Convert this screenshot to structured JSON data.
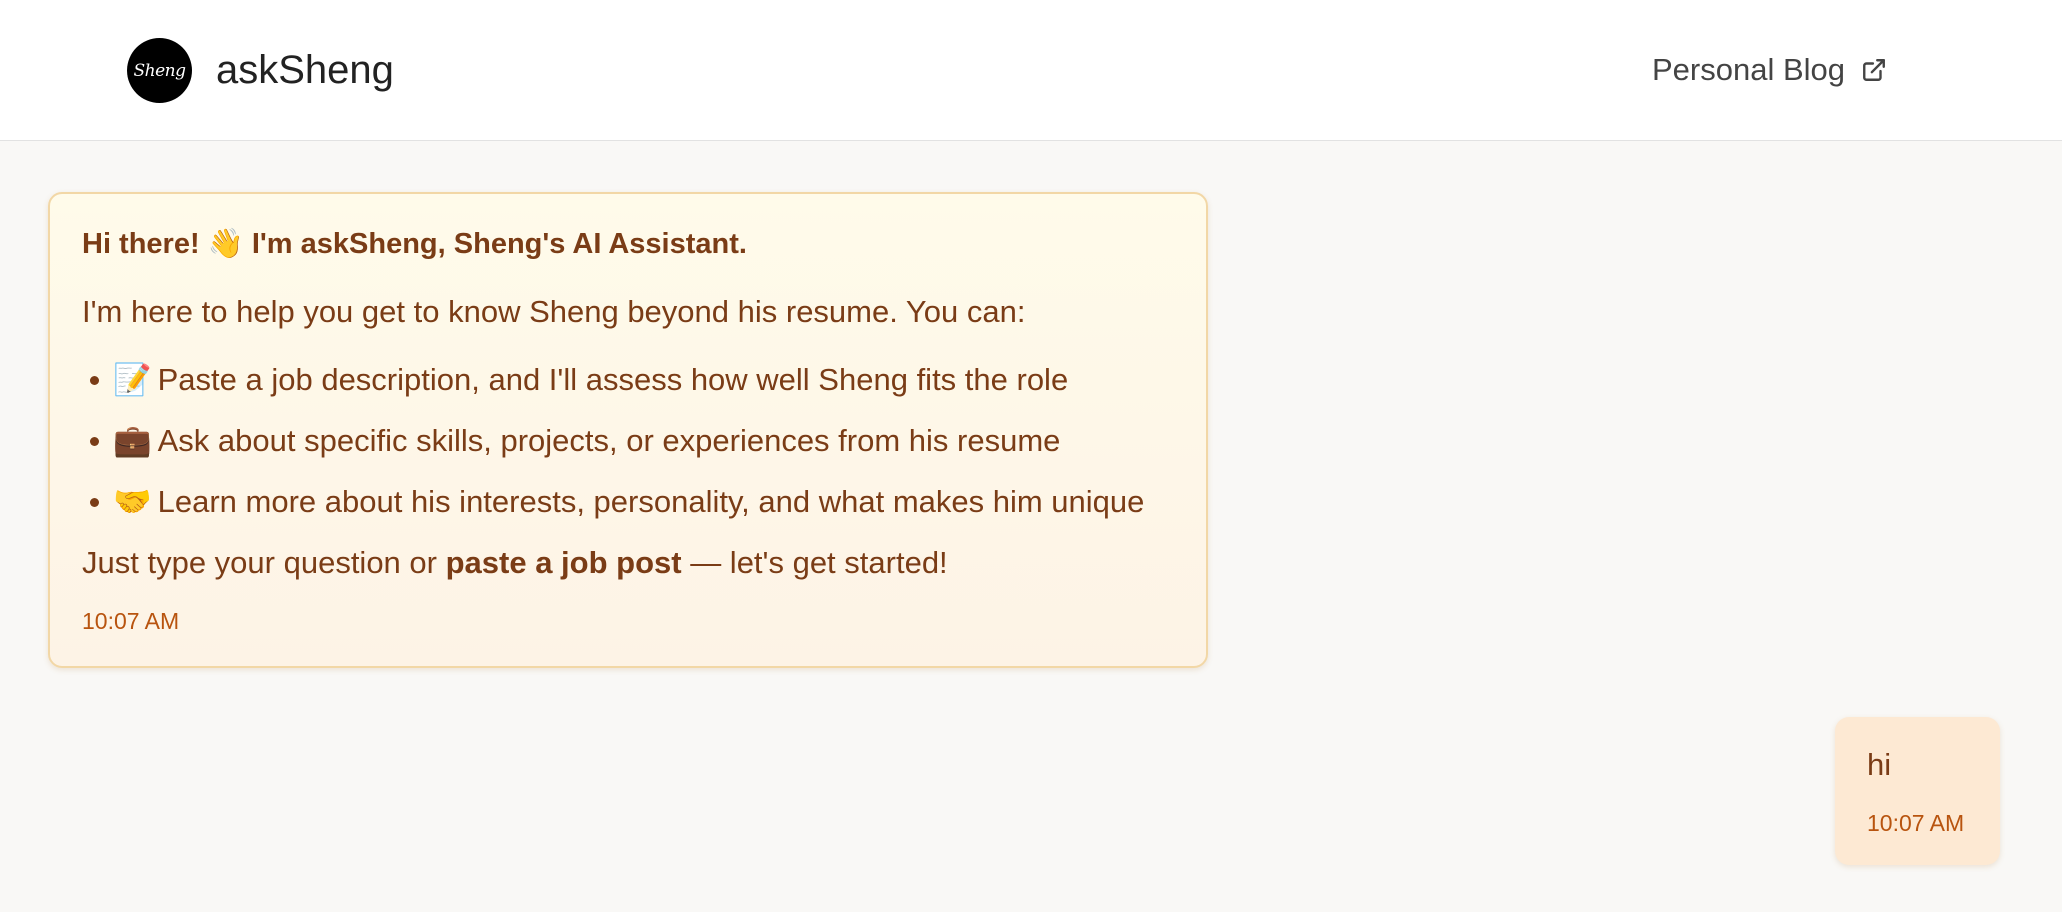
{
  "header": {
    "logo_text": "Sheng",
    "title": "askSheng",
    "blog_link_label": "Personal Blog",
    "blog_link_icon": "external-link-icon"
  },
  "messages": {
    "bot": {
      "heading": "Hi there! 👋 I'm askSheng, Sheng's AI Assistant.",
      "intro": "I'm here to help you get to know Sheng beyond his resume. You can:",
      "items": [
        {
          "emoji": "📝",
          "text": "Paste a job description, and I'll assess how well Sheng fits the role"
        },
        {
          "emoji": "💼",
          "text": "Ask about specific skills, projects, or experiences from his resume"
        },
        {
          "emoji": "🤝",
          "text": "Learn more about his interests, personality, and what makes him unique"
        }
      ],
      "outro_before": "Just type your question or ",
      "outro_bold": "paste a job post",
      "outro_after": " — let's get started!",
      "time": "10:07 AM"
    },
    "user": {
      "text": "hi",
      "time": "10:07 AM"
    }
  },
  "colors": {
    "bot_text": "#7a3c16",
    "timestamp": "#b8540f",
    "bot_border": "#f2d7a6",
    "user_bubble": "#fde9d3"
  }
}
